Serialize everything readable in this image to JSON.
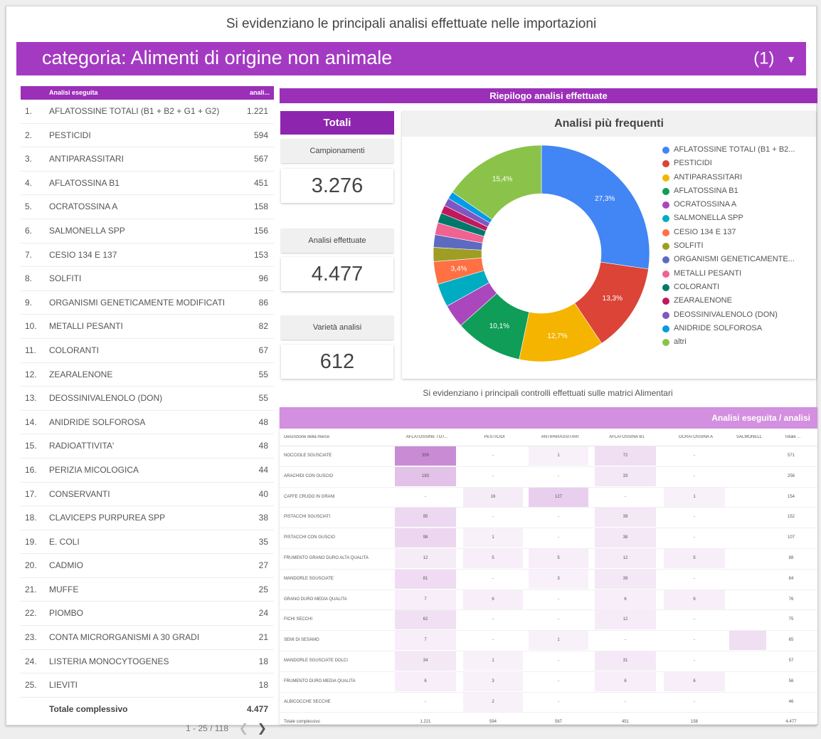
{
  "header": {
    "title": "Si evidenziano le principali analisi effettuate nelle importazioni"
  },
  "category": {
    "prefix": "categoria",
    "value": "Alimenti di origine non animale",
    "count": "(1)",
    "chevron_icon": "dropdown-triangle-icon"
  },
  "left_table": {
    "col_label": "Analisi eseguita",
    "col_value": "anali...",
    "rows": [
      {
        "n": "1.",
        "label": "AFLATOSSINE TOTALI (B1 + B2 + G1 + G2)",
        "value": "1.221"
      },
      {
        "n": "2.",
        "label": "PESTICIDI",
        "value": "594"
      },
      {
        "n": "3.",
        "label": "ANTIPARASSITARI",
        "value": "567"
      },
      {
        "n": "4.",
        "label": "AFLATOSSINA B1",
        "value": "451"
      },
      {
        "n": "5.",
        "label": "OCRATOSSINA A",
        "value": "158"
      },
      {
        "n": "6.",
        "label": "SALMONELLA SPP",
        "value": "156"
      },
      {
        "n": "7.",
        "label": "CESIO 134 E 137",
        "value": "153"
      },
      {
        "n": "8.",
        "label": "SOLFITI",
        "value": "96"
      },
      {
        "n": "9.",
        "label": "ORGANISMI GENETICAMENTE MODIFICATI",
        "value": "86"
      },
      {
        "n": "10.",
        "label": "METALLI PESANTI",
        "value": "82"
      },
      {
        "n": "11.",
        "label": "COLORANTI",
        "value": "67"
      },
      {
        "n": "12.",
        "label": "ZEARALENONE",
        "value": "55"
      },
      {
        "n": "13.",
        "label": "DEOSSINIVALENOLO (DON)",
        "value": "55"
      },
      {
        "n": "14.",
        "label": "ANIDRIDE SOLFOROSA",
        "value": "48"
      },
      {
        "n": "15.",
        "label": "RADIOATTIVITA'",
        "value": "48"
      },
      {
        "n": "16.",
        "label": "PERIZIA MICOLOGICA",
        "value": "44"
      },
      {
        "n": "17.",
        "label": "CONSERVANTI",
        "value": "40"
      },
      {
        "n": "18.",
        "label": "CLAVICEPS PURPUREA SPP",
        "value": "38"
      },
      {
        "n": "19.",
        "label": "E. COLI",
        "value": "35"
      },
      {
        "n": "20.",
        "label": "CADMIO",
        "value": "27"
      },
      {
        "n": "21.",
        "label": "MUFFE",
        "value": "25"
      },
      {
        "n": "22.",
        "label": "PIOMBO",
        "value": "24"
      },
      {
        "n": "23.",
        "label": "CONTA MICRORGANISMI A 30 GRADI",
        "value": "21"
      },
      {
        "n": "24.",
        "label": "LISTERIA MONOCYTOGENES",
        "value": "18"
      },
      {
        "n": "25.",
        "label": "LIEVITI",
        "value": "18"
      }
    ],
    "total_label": "Totale complessivo",
    "total_value": "4.477",
    "pagination": "1 - 25 / 118",
    "prev_icon": "chevron-left-icon",
    "next_icon": "chevron-right-icon"
  },
  "summary": {
    "title": "Riepilogo analisi effettuate",
    "totali_label": "Totali",
    "kpis": [
      {
        "label": "Campionamenti",
        "value": "3.276"
      },
      {
        "label": "Analisi effettuate",
        "value": "4.477"
      },
      {
        "label": "Varietà analisi",
        "value": "612"
      }
    ]
  },
  "chart_data": {
    "type": "pie",
    "title": "Analisi più frequenti",
    "donut": true,
    "slices": [
      {
        "label": "AFLATOSSINE TOTALI (B1 + B2...",
        "value": 27.3,
        "color": "#4285f4",
        "data_label": "27,3%"
      },
      {
        "label": "PESTICIDI",
        "value": 13.3,
        "color": "#db4437",
        "data_label": "13,3%"
      },
      {
        "label": "ANTIPARASSITARI",
        "value": 12.7,
        "color": "#f4b400",
        "data_label": "12,7%"
      },
      {
        "label": "AFLATOSSINA B1",
        "value": 10.1,
        "color": "#0f9d58",
        "data_label": "10,1%"
      },
      {
        "label": "OCRATOSSINA A",
        "value": 3.5,
        "color": "#ab47bc",
        "data_label": ""
      },
      {
        "label": "SALMONELLA SPP",
        "value": 3.5,
        "color": "#00acc1",
        "data_label": ""
      },
      {
        "label": "CESIO 134 E 137",
        "value": 3.4,
        "color": "#ff7043",
        "data_label": "3,4%"
      },
      {
        "label": "SOLFITI",
        "value": 2.1,
        "color": "#9e9d24",
        "data_label": ""
      },
      {
        "label": "ORGANISMI GENETICAMENTE...",
        "value": 1.9,
        "color": "#5c6bc0",
        "data_label": ""
      },
      {
        "label": "METALLI PESANTI",
        "value": 1.8,
        "color": "#f06292",
        "data_label": ""
      },
      {
        "label": "COLORANTI",
        "value": 1.5,
        "color": "#00796b",
        "data_label": ""
      },
      {
        "label": "ZEARALENONE",
        "value": 1.2,
        "color": "#c2185b",
        "data_label": ""
      },
      {
        "label": "DEOSSINIVALENOLO (DON)",
        "value": 1.2,
        "color": "#7e57c2",
        "data_label": ""
      },
      {
        "label": "ANIDRIDE SOLFOROSA",
        "value": 1.1,
        "color": "#039be5",
        "data_label": ""
      },
      {
        "label": "altri",
        "value": 15.4,
        "color": "#8bc34a",
        "data_label": "15,4%"
      }
    ]
  },
  "pivot": {
    "subtitle": "Si evidenziano  i principali controlli effettuati sulle matrici Alimentari",
    "header": "Analisi eseguita / analisi",
    "columns": [
      "Descrizione della merce",
      "AFLATOSSINE TOT...",
      "PESTICIDI",
      "ANTIPARASSITARI",
      "AFLATOSSINA B1",
      "OCRATOSSINA A",
      "SALMONELL",
      "Totale ..."
    ],
    "rows": [
      {
        "label": "NOCCIOLE SGUSCIATE",
        "cells": [
          "399",
          "-",
          "1",
          "72",
          "-",
          "",
          "571"
        ]
      },
      {
        "label": "ARACHIDI CON GUSCIO",
        "cells": [
          "183",
          "-",
          "-",
          "33",
          "-",
          "",
          "256"
        ]
      },
      {
        "label": "CAFFE CRUDO IN GRANI",
        "cells": [
          "-",
          "16",
          "127",
          "-",
          "1",
          "",
          "154"
        ]
      },
      {
        "label": "PISTACCHI SGUSCIATI",
        "cells": [
          "95",
          "-",
          "-",
          "39",
          "-",
          "",
          "152"
        ]
      },
      {
        "label": "PISTACCHI CON GUSCIO",
        "cells": [
          "98",
          "1",
          "-",
          "38",
          "-",
          "",
          "107"
        ]
      },
      {
        "label": "FRUMENTO GRANO DURO ALTA QUALITA",
        "cells": [
          "12",
          "5",
          "5",
          "12",
          "5",
          "",
          "88"
        ]
      },
      {
        "label": "MANDORLE SGUSCIATE",
        "cells": [
          "81",
          "-",
          "3",
          "39",
          "-",
          "",
          "84"
        ]
      },
      {
        "label": "GRANO DURO MEDIA QUALITA",
        "cells": [
          "7",
          "6",
          "-",
          "6",
          "6",
          "",
          "76"
        ]
      },
      {
        "label": "FICHI SECCHI",
        "cells": [
          "62",
          "-",
          "-",
          "12",
          "-",
          "",
          "75"
        ]
      },
      {
        "label": "SEMI DI SESAMO",
        "cells": [
          "7",
          "-",
          "1",
          "-",
          "-",
          "",
          "65"
        ]
      },
      {
        "label": "MANDORLE SGUSCIATE DOLCI",
        "cells": [
          "34",
          "1",
          "-",
          "31",
          "-",
          "",
          "57"
        ]
      },
      {
        "label": "FRUMENTO DURO MEDIA QUALITA",
        "cells": [
          "6",
          "3",
          "-",
          "6",
          "6",
          "",
          "56"
        ]
      },
      {
        "label": "ALBICOCCHE SECCHE",
        "cells": [
          "-",
          "2",
          "-",
          "-",
          "-",
          "",
          "46"
        ]
      }
    ],
    "total_label": "Totale complessivo",
    "total_cells": [
      "1.221",
      "594",
      "567",
      "451",
      "158",
      "",
      "4.477"
    ]
  }
}
